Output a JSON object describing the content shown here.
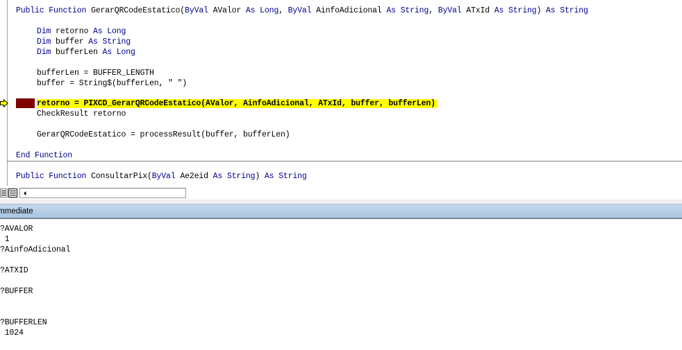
{
  "code_window": {
    "lines": {
      "l1": {
        "k1": "Public Function ",
        "t1": "GerarQRCodeEstatico(",
        "k2": "ByVal ",
        "t2": "AValor ",
        "k3": "As Long",
        "t3": ", ",
        "k4": "ByVal ",
        "t4": "AinfoAdicional ",
        "k5": "As String",
        "t5": ", ",
        "k6": "ByVal ",
        "t6": "ATxId ",
        "k7": "As String",
        "t7": ") ",
        "k8": "As String"
      },
      "l2": {
        "k1": "Dim ",
        "t1": "retorno ",
        "k2": "As Long"
      },
      "l3": {
        "k1": "Dim ",
        "t1": "buffer ",
        "k2": "As String"
      },
      "l4": {
        "k1": "Dim ",
        "t1": "bufferLen ",
        "k2": "As Long"
      },
      "l5": "bufferLen = BUFFER_LENGTH",
      "l6": "buffer = String$(bufferLen, \" \")",
      "l7": "retorno = PIXCD_GerarQRCodeEstatico(AValor, AinfoAdicional, ATxId, buffer, bufferLen)",
      "l8": "CheckResult retorno",
      "l9": "GerarQRCodeEstatico = processResult(buffer, bufferLen)",
      "l10": {
        "k1": "End Function"
      },
      "l11": {
        "k1": "Public Function ",
        "t1": "ConsultarPix(",
        "k2": "ByVal ",
        "t2": "Ae2eid ",
        "k3": "As String",
        "t3": ") ",
        "k4": "As String"
      }
    }
  },
  "immediate_window": {
    "title": "Immediate",
    "lines": [
      "?AVALOR",
      " 1",
      "?AinfoAdicional",
      "?ATXID",
      "?BUFFER",
      "?BUFFERLEN",
      " 1024"
    ]
  },
  "colors": {
    "keyword": "#00008b",
    "exec_highlight": "#ffff00",
    "breakpoint": "#800000",
    "titlebar": "#b6cde6"
  },
  "icons": {
    "exec_arrow": "execution-pointer-icon",
    "view_toggle": "procedure-view-icon",
    "scroll_left": "scroll-left-arrow-icon"
  }
}
